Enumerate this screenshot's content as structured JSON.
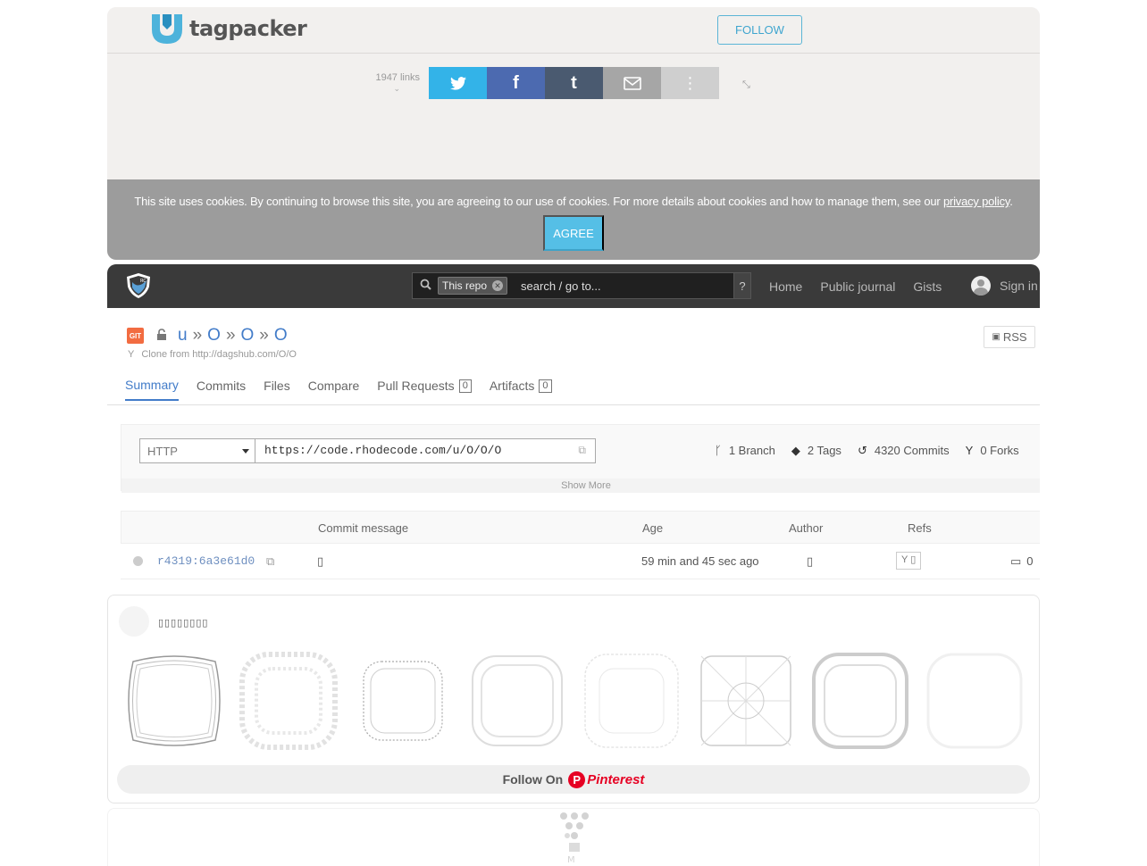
{
  "tagpacker": {
    "logo_text": "tagpacker",
    "follow_label": "FOLLOW",
    "link_count": "1947 links",
    "share_buttons": [
      "twitter",
      "facebook",
      "tumblr",
      "email",
      "more"
    ]
  },
  "cookie_banner": {
    "text": "This site uses cookies. By continuing to browse this site, you are agreeing to our use of cookies. For more details about cookies and how to manage them, see our ",
    "link": "privacy policy",
    "suffix": ".",
    "agree_label": "AGREE"
  },
  "rhodecode": {
    "search": {
      "scope_chip": "This repo",
      "placeholder": "search / go to...",
      "help": "?"
    },
    "nav_links": [
      "Home",
      "Public journal",
      "Gists"
    ],
    "sign_in": "Sign in",
    "breadcrumb": [
      "u",
      "O",
      "O",
      "O"
    ],
    "breadcrumb_sep": "»",
    "clone_from": "Clone from http://dagshub.com/O/O",
    "rss_label": "RSS",
    "tabs": [
      {
        "label": "Summary",
        "active": true
      },
      {
        "label": "Commits"
      },
      {
        "label": "Files"
      },
      {
        "label": "Compare"
      },
      {
        "label": "Pull Requests",
        "count": "0"
      },
      {
        "label": "Artifacts",
        "count": "0"
      }
    ],
    "clone": {
      "protocol": "HTTP",
      "url": "https://code.rhodecode.com/u/O/O/O"
    },
    "stats": {
      "branches": "1 Branch",
      "tags": "2 Tags",
      "commits": "4320 Commits",
      "forks": "0 Forks"
    },
    "show_more": "Show More",
    "table": {
      "headers": [
        "Commit message",
        "Age",
        "Author",
        "Refs"
      ],
      "rows": [
        {
          "hash": "r4319:6a3e61d0",
          "message": "▯",
          "age": "59 min and 45 sec ago",
          "author": "▯",
          "ref": "Y ▯",
          "comments": "0"
        }
      ]
    }
  },
  "pinterest": {
    "board_name": "▯▯▯▯▯▯▯▯",
    "follow_on": "Follow On",
    "brand": "Pinterest"
  },
  "colors": {
    "accent": "#427cc9",
    "tagpacker_blue": "#3fa5cf",
    "pinterest_red": "#e60023",
    "nav_bg": "#3a3a3a"
  }
}
